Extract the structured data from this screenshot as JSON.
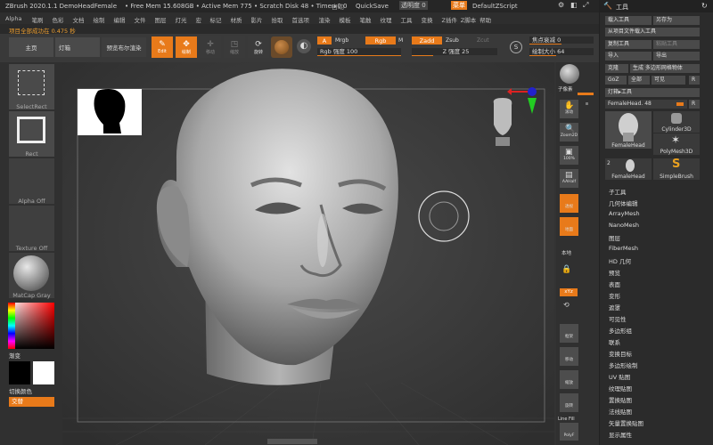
{
  "titlebar": {
    "app": "ZBrush 2020.1.1 DemoHeadFemale",
    "mem": "• Free Mem 15.608GB • Active Mem 775 • Scratch Disk 48 • Timer▸0.0",
    "mode": "自动",
    "quicksave": "QuickSave",
    "transparent": "透明度 0",
    "menu_btn": "菜单",
    "script": "DefaultZScript"
  },
  "menubar": [
    "Alpha",
    "笔刷",
    "色彩",
    "文档",
    "绘制",
    "编辑",
    "文件",
    "图层",
    "灯光",
    "宏",
    "标记",
    "材质",
    "影片",
    "拾取",
    "首选项",
    "渲染",
    "模板",
    "笔触",
    "纹理",
    "工具",
    "变换",
    "Z插件",
    "Z脚本",
    "帮助"
  ],
  "status": "项目全部成功在 0.475 秒",
  "toolbar": {
    "home": "主页",
    "lightbox": "灯箱",
    "preview": "预览布尔渲染",
    "edit": "Edit",
    "draw": "绘制",
    "move": "移动",
    "scale": "缩放",
    "rotate": "旋转",
    "a_btn": "A",
    "mrgb": "Mrgb",
    "rgb": "Rgb",
    "m": "M",
    "zadd": "Zadd",
    "zsub": "Zsub",
    "zcut": "Zcut",
    "rgb_intensity_label": "Rgb 强度 100",
    "rgb_intensity": 100,
    "z_intensity_label": "Z 强度 25",
    "z_intensity": 25,
    "focal_label": "焦点衰减 0",
    "draw_size_label": "绘制大小 64"
  },
  "leftshelf": {
    "select_rect": "SelectRect",
    "rect": "Rect",
    "alpha": "Alpha Off",
    "texture": "Texture Off",
    "matcap": "MatCap Gray",
    "gradient": "渐变",
    "switch_color": "切换颜色",
    "alternate": "交替"
  },
  "rightshelf": {
    "bpr": "BPR",
    "subpix": "子像素",
    "scroll": "滚动",
    "zoom": "Zoom2D",
    "actual": "100%",
    "aahalf": "AAHalf",
    "persp": "透视",
    "floor": "地面",
    "local": "本地",
    "xyz": "xYz",
    "frame": "框架",
    "move": "移动",
    "scale": "缩放",
    "rotate": "旋转",
    "linefill": "Line Fill",
    "polyf": "PolyF"
  },
  "panel": {
    "title": "工具",
    "buttons": [
      {
        "label": "载入工具",
        "col": 0
      },
      {
        "label": "另存为",
        "col": 1
      },
      {
        "label": "从项目文件载入工具",
        "col": 0
      },
      {
        "label": "复制工具",
        "col": 0
      },
      {
        "label": "粘贴工具",
        "col": 1
      },
      {
        "label": "导入",
        "col": 0
      },
      {
        "label": "导出",
        "col": 1
      }
    ],
    "clone": "克隆",
    "multi": "生成 多边形网格物体",
    "goz": "GoZ",
    "all": "全部",
    "visible": "可见",
    "r": "R",
    "lightbox_tools": "灯箱▸工具",
    "current_tool": "FemaleHead. 48",
    "tools": [
      {
        "name": "FemaleHead"
      },
      {
        "name": "Cylinder3D"
      },
      {
        "name": "PolyMesh3D"
      },
      {
        "name": "FemaleHead"
      },
      {
        "name": "SimpleBrush"
      }
    ],
    "small_count": "2",
    "list": [
      "子工具",
      "几何体编辑",
      "ArrayMesh",
      "NanoMesh",
      "图层",
      "FiberMesh",
      "HD 几何",
      "预览",
      "表面",
      "变形",
      "遮罩",
      "可见性",
      "多边形组",
      "联系",
      "变换目标",
      "多边形绘制",
      "UV 贴图",
      "纹理贴图",
      "置换贴图",
      "法线贴图",
      "矢量置换贴图",
      "显示属性"
    ]
  },
  "colors": {
    "accent": "#e87a1a",
    "background": "#333333",
    "canvas": "#3a3a3a"
  }
}
